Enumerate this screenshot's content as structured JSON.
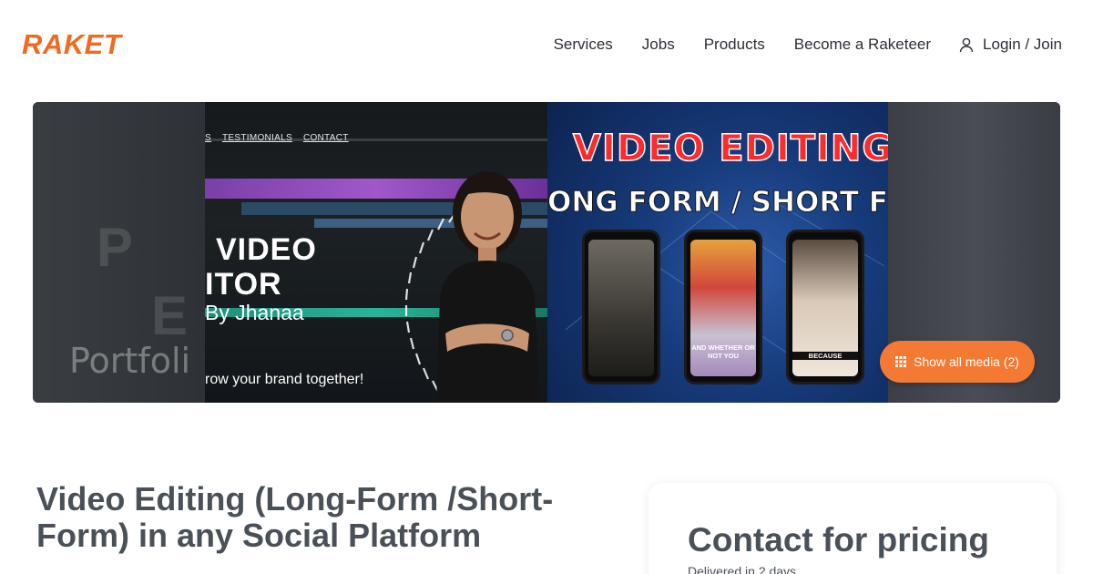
{
  "brand": {
    "logo": "RAKET",
    "accent": "#f26a21"
  },
  "nav": {
    "items": [
      "Services",
      "Jobs",
      "Products",
      "Become a Raketeer"
    ],
    "login_label": "Login / Join"
  },
  "hero": {
    "left_panel": {
      "faded_text": "Portfoli"
    },
    "mid_panel": {
      "top_nav": [
        "S",
        "TESTIMONIALS",
        "CONTACT"
      ],
      "title_line1": "VIDEO",
      "title_line2": "ITOR",
      "byline": "By Jhanaa",
      "tagline": "row your brand together!"
    },
    "right_panel": {
      "title": "VIDEO EDITING",
      "subtitle": "ONG FORM / SHORT FO",
      "phone_captions": [
        "",
        "AND WHETHER OR NOT YOU",
        "BECAUSE"
      ]
    },
    "media_button_label": "Show all media (2)"
  },
  "listing": {
    "title": "Video Editing (Long-Form /Short-Form) in any Social Platform"
  },
  "pricing": {
    "title": "Contact for pricing",
    "delivery": "Delivered in 2 days"
  }
}
